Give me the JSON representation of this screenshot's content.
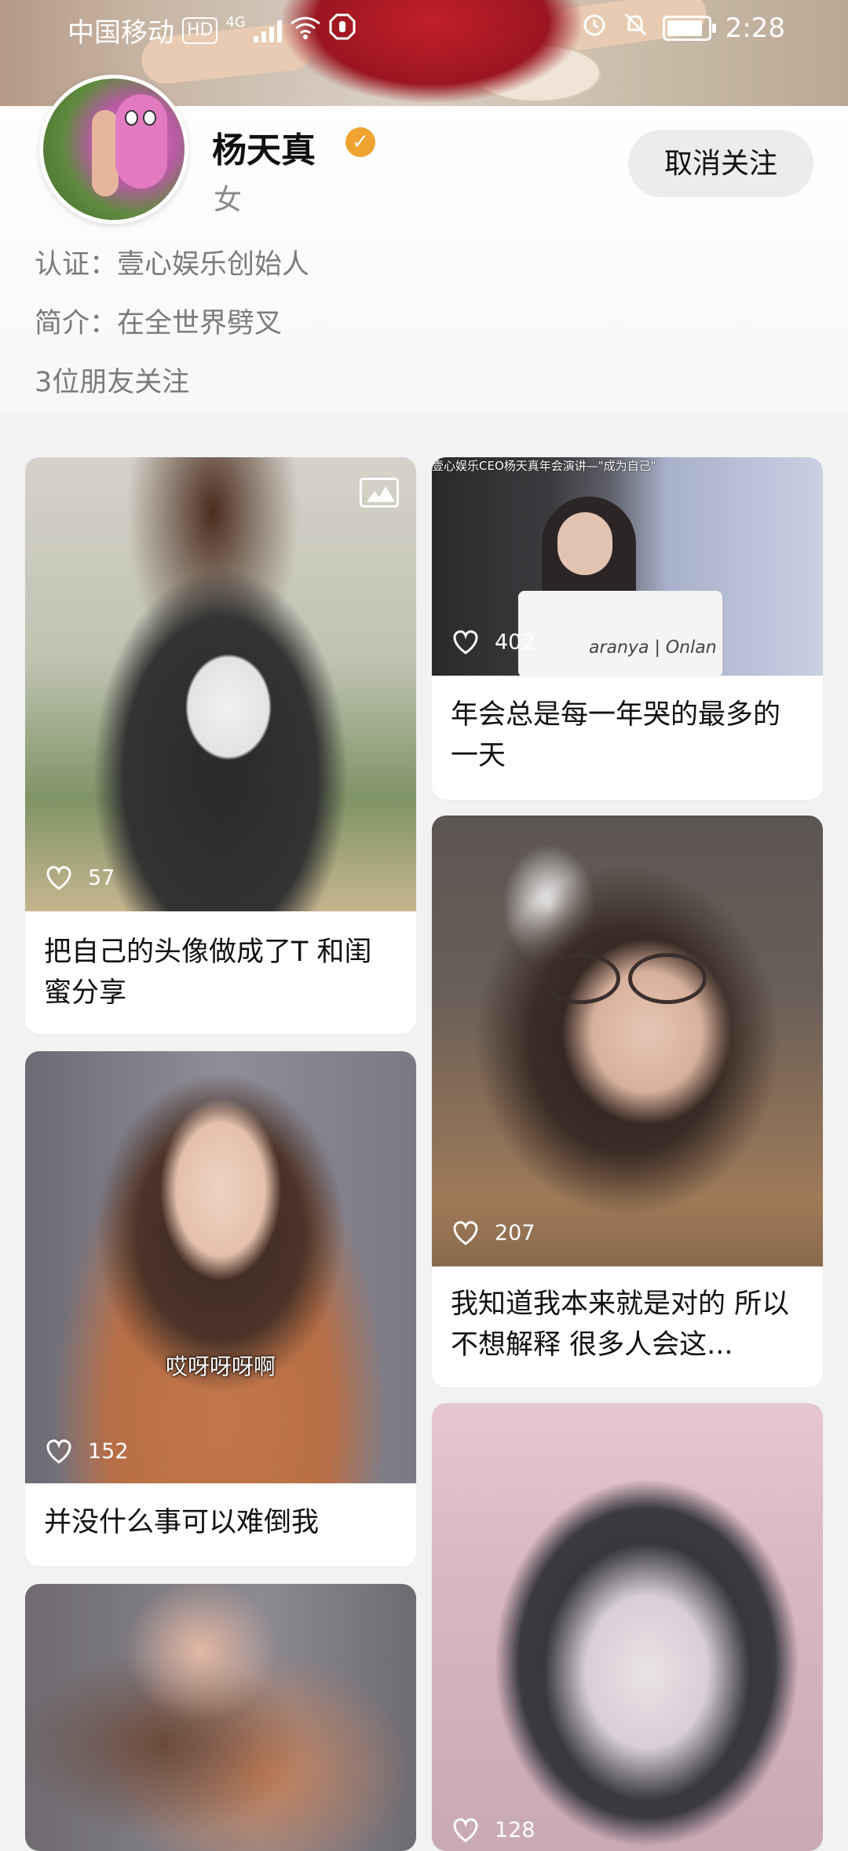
{
  "status_bar": {
    "carrier": "中国移动",
    "hd": "HD",
    "network": "4G",
    "time": "2:28"
  },
  "profile": {
    "name": "杨天真",
    "gender": "女",
    "follow_button": "取消关注",
    "certification": "认证：壹心娱乐创始人",
    "bio": "简介：在全世界劈叉",
    "friends_following": "3位朋友关注"
  },
  "feed": {
    "left": [
      {
        "likes": "57",
        "caption": "把自己的头像做成了T 和闺蜜分享",
        "has_image_badge": true
      },
      {
        "likes": "152",
        "caption": "并没什么事可以难倒我",
        "subtitle": "哎呀呀呀啊"
      },
      {
        "likes": "",
        "caption": ""
      }
    ],
    "right": [
      {
        "likes": "402",
        "caption": "年会总是每一年哭的最多的一天",
        "overlay_text": "壹心娱乐CEO杨天真年会演讲—\"成为自己\"",
        "podium_text": "aranya | Onlan"
      },
      {
        "likes": "207",
        "caption": "我知道我本来就是对的 所以不想解释 很多人会这..."
      },
      {
        "likes": "128",
        "caption": ""
      }
    ]
  }
}
